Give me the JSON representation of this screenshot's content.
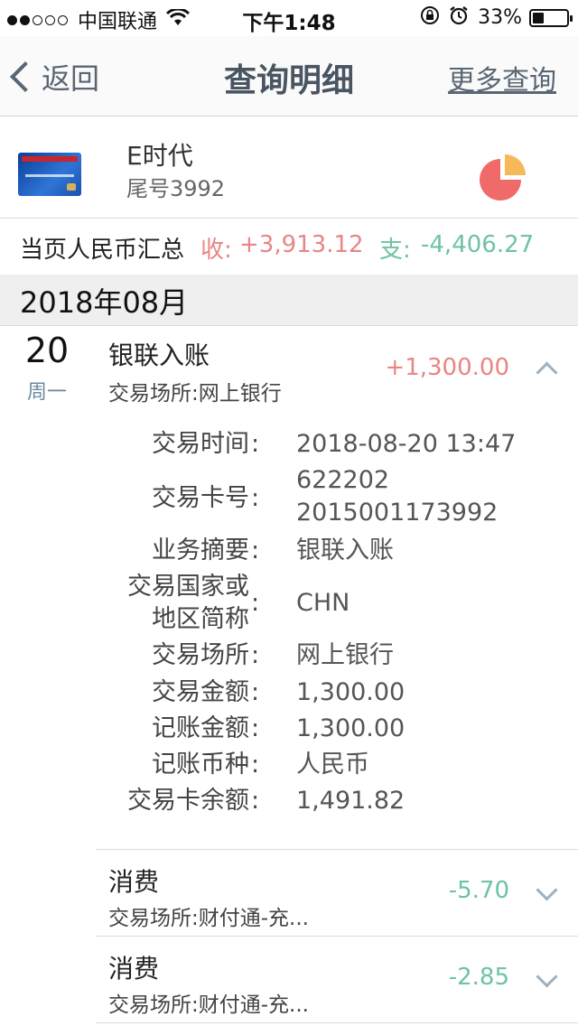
{
  "status_bar": {
    "carrier": "中国联通",
    "time": "下午1:48",
    "battery_pct": "33%",
    "battery_level": 0.33,
    "signal_bars_filled": 2,
    "signal_bars_total": 5
  },
  "nav": {
    "back_label": "返回",
    "title": "查询明细",
    "more_label": "更多查询"
  },
  "card": {
    "name": "E时代",
    "tail": "尾号3992"
  },
  "summary": {
    "label": "当页人民币汇总",
    "income_label": "收:",
    "income_value": "+3,913.12",
    "expense_label": "支:",
    "expense_value": "-4,406.27"
  },
  "month": {
    "label": "2018年08月"
  },
  "day": {
    "number": "20",
    "weekday": "周一"
  },
  "transactions": [
    {
      "title": "银联入账",
      "subtitle": "交易场所:网上银行",
      "amount": "+1,300.00",
      "expanded": true
    },
    {
      "title": "消费",
      "subtitle": "交易场所:财付通-充...",
      "amount": "-5.70",
      "expanded": false
    },
    {
      "title": "消费",
      "subtitle": "交易场所:财付通-充...",
      "amount": "-2.85",
      "expanded": false
    }
  ],
  "details": {
    "time_label": "交易时间",
    "time_value": "2018-08-20 13:47",
    "card_label": "交易卡号",
    "card_value_line1": "622202",
    "card_value_line2": "2015001173992",
    "summary_label": "业务摘要",
    "summary_value": "银联入账",
    "country_label_line1": "交易国家或",
    "country_label_line2": "地区简称",
    "country_value": "CHN",
    "place_label": "交易场所",
    "place_value": "网上银行",
    "amount_label": "交易金额",
    "amount_value": "1,300.00",
    "booked_label": "记账金额",
    "booked_value": "1,300.00",
    "currency_label": "记账币种",
    "currency_value": "人民币",
    "balance_label": "交易卡余额",
    "balance_value": "1,491.82",
    "colon": ":"
  },
  "colors": {
    "income": "#e98585",
    "expense": "#6dc3a2",
    "nav_text": "#5a6673",
    "weekday": "#6a8aa3"
  }
}
